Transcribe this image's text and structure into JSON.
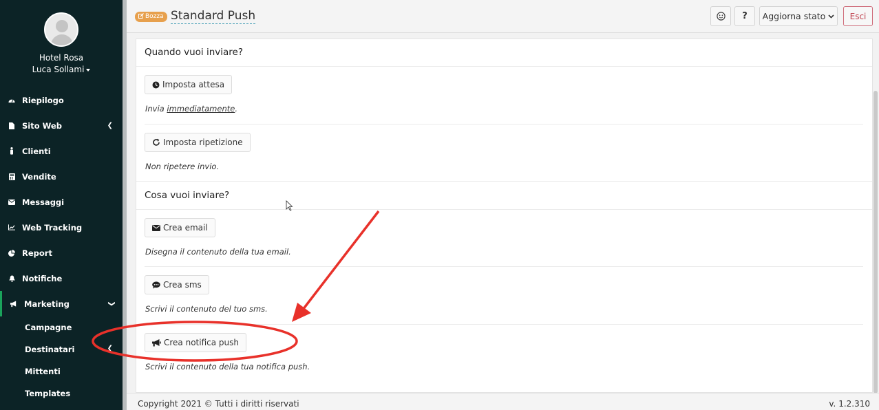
{
  "sidebar": {
    "org_name": "Hotel Rosa",
    "user_name": "Luca Sollami",
    "items": [
      {
        "label": "Riepilogo",
        "icon": "dashboard-icon"
      },
      {
        "label": "Sito Web",
        "icon": "file-icon"
      },
      {
        "label": "Clienti",
        "icon": "person-icon"
      },
      {
        "label": "Vendite",
        "icon": "calculator-icon"
      },
      {
        "label": "Messaggi",
        "icon": "envelope-icon"
      },
      {
        "label": "Web Tracking",
        "icon": "line-chart-icon"
      },
      {
        "label": "Report",
        "icon": "pie-chart-icon"
      },
      {
        "label": "Notifiche",
        "icon": "bell-icon"
      },
      {
        "label": "Marketing",
        "icon": "bullhorn-icon"
      }
    ],
    "subitems": [
      "Campagne",
      "Destinatari",
      "Mittenti",
      "Templates"
    ]
  },
  "header": {
    "badge": "Bozza",
    "title": "Standard Push",
    "help": "?",
    "status_label": "Aggiorna stato",
    "exit_label": "Esci"
  },
  "main": {
    "when_title": "Quando vuoi inviare?",
    "wait_button": "Imposta attesa",
    "wait_desc_prefix": "Invia ",
    "wait_desc_link": "immediatamente",
    "wait_desc_suffix": ".",
    "repeat_button": "Imposta ripetizione",
    "repeat_desc": "Non ripetere invio.",
    "what_title": "Cosa vuoi inviare?",
    "email_button": "Crea email",
    "email_desc": "Disegna il contenuto della tua email.",
    "sms_button": "Crea sms",
    "sms_desc": "Scrivi il contenuto del tuo sms.",
    "push_button": "Crea notifica push",
    "push_desc": "Scrivi il contenuto della tua notifica push."
  },
  "footer": {
    "copyright": "Copyright 2021 © Tutti i diritti riservati",
    "version": "v. 1.2.310"
  },
  "colors": {
    "sidebar_bg": "#0c2326",
    "badge": "#e7a04d",
    "exit": "#c0434f",
    "annotation": "#e8312a"
  }
}
